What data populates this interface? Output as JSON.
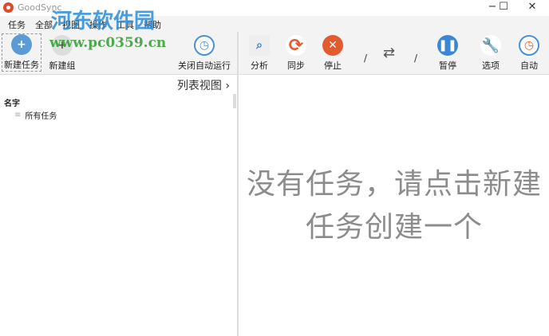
{
  "window": {
    "title": "GoodSync",
    "minimize": "−",
    "maximize": "☐",
    "close": "✕"
  },
  "menu": [
    "任务",
    "全部",
    "视图",
    "操作",
    "工具",
    "帮助"
  ],
  "toolbar": {
    "new_task": "新建任务",
    "new_group": "新建组",
    "auto_off": "关闭自动运行",
    "analyze": "分析",
    "sync": "同步",
    "stop": "停止",
    "slash1": "/",
    "swap": "⇄",
    "slash2": "/",
    "pause": "暂停",
    "options": "选项",
    "auto": "自动"
  },
  "left": {
    "list_view": "列表视图",
    "chevron": "›",
    "column": "名字",
    "items": [
      "所有任务"
    ]
  },
  "main": {
    "empty_message": "没有任务，请点击新建任务创建一个"
  },
  "watermark": {
    "site_name": "河东软件园",
    "url": "www.pc0359.cn"
  }
}
